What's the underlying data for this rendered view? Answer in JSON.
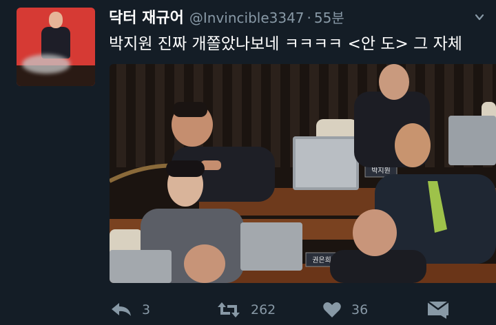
{
  "tweet": {
    "author": {
      "display_name": "닥터 재규어",
      "handle": "@Invincible3347",
      "separator": "·",
      "time": "55분"
    },
    "text": "박지원 진짜 개쫄았나보네 ㅋㅋㅋㅋ <안 도> 그 자체",
    "media": {
      "nameplates": [
        "박지원",
        "권은희"
      ]
    },
    "actions": {
      "reply": {
        "icon": "reply-icon",
        "count": "3"
      },
      "retweet": {
        "icon": "retweet-icon",
        "count": "262"
      },
      "like": {
        "icon": "heart-icon",
        "count": "36"
      },
      "message": {
        "icon": "direct-message-icon"
      }
    }
  },
  "colors": {
    "background": "#141d26",
    "text": "#ffffff",
    "muted": "#8899a6"
  }
}
